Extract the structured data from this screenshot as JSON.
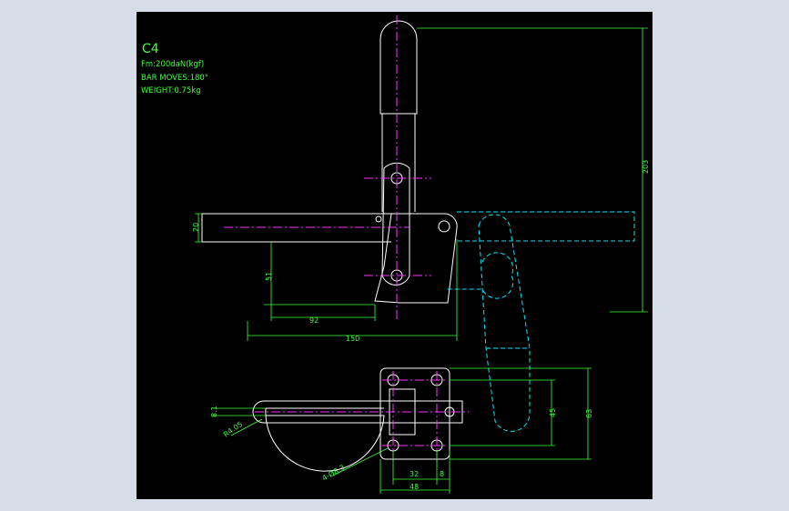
{
  "viewport": {
    "background": "#000000",
    "frame_color": "#d6dde6"
  },
  "colors": {
    "outline": "#ffffff",
    "centerline": "#ff33ff",
    "dimension": "#3dff3d",
    "ghost": "#00e5ff"
  },
  "notes": {
    "model": "C4",
    "force": "Fm:200daN(kgf)",
    "travel": "BAR MOVES:180°",
    "weight": "WEIGHT:0.75kg"
  },
  "dimensions": {
    "total_height": "203",
    "bar_dia": "20",
    "pivot_height": "51",
    "pivot_length": "92",
    "overall_length": "150",
    "slot_width": "8.1",
    "slot_radius": "R4.05",
    "hole_spec": "4-Ø8.3",
    "hole_spacing_y": "45",
    "base_height": "63",
    "hole_spacing_x": "32",
    "edge_offset": "8",
    "base_width": "48"
  }
}
